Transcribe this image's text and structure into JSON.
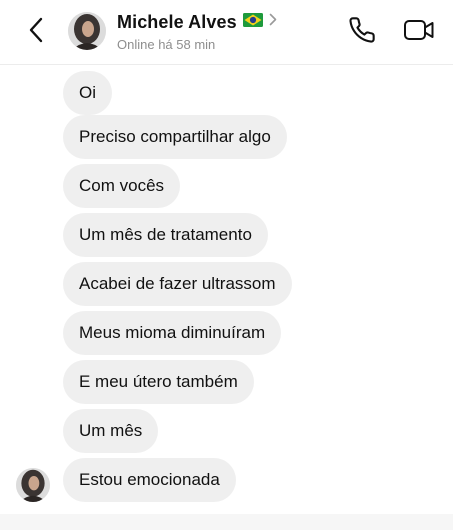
{
  "header": {
    "name": "Michele Alves",
    "flag": "🇧🇷",
    "status": "Online há 58 min",
    "icons": {
      "back": "chevron-left-icon",
      "profile": "chevron-right-icon",
      "call": "phone-icon",
      "video": "video-camera-icon"
    }
  },
  "messages": [
    "Oi",
    "Preciso compartilhar algo",
    "Com vocês",
    "Um mês de tratamento",
    "Acabei de fazer ultrassom",
    "Meus mioma diminuíram",
    "E meu útero também",
    "Um mês",
    "Estou emocionada"
  ],
  "colors": {
    "bubble": "#efefef",
    "status_text": "#8e8e8e",
    "text": "#111111"
  }
}
